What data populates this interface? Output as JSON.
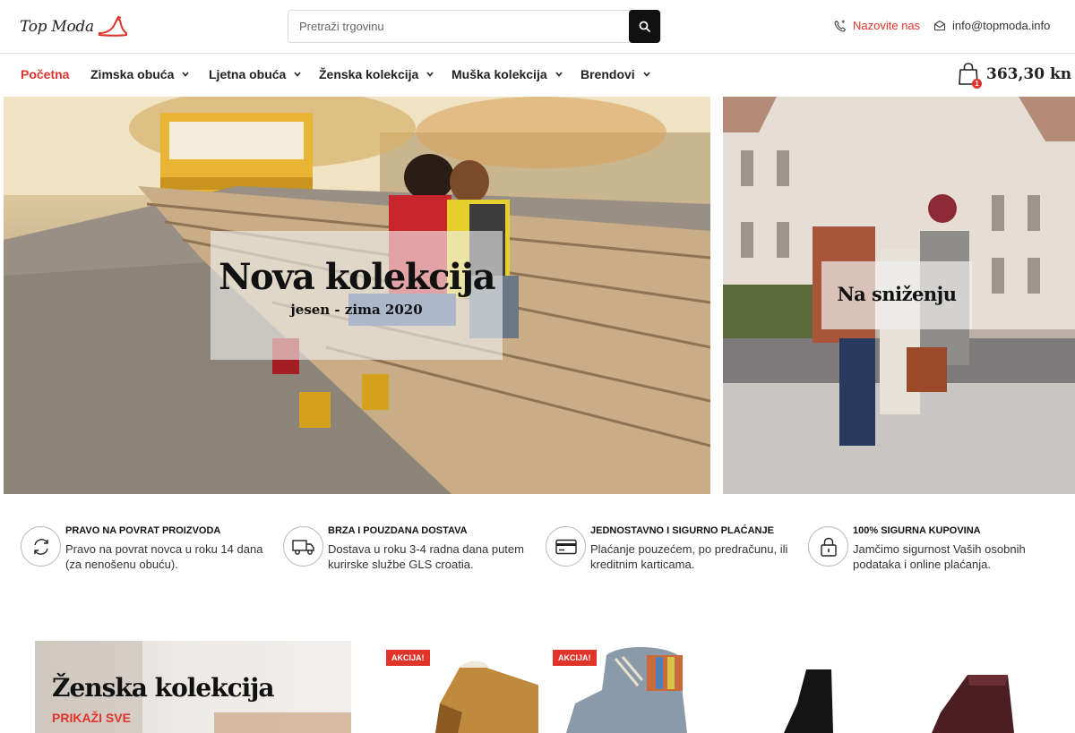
{
  "header": {
    "logo_text": "Top Moda",
    "search_placeholder": "Pretraži trgovinu",
    "phone_label": "Nazovite nas",
    "email": "info@topmoda.info"
  },
  "nav": {
    "items": [
      {
        "label": "Početna",
        "dropdown": false,
        "active": true
      },
      {
        "label": "Zimska obuća",
        "dropdown": true
      },
      {
        "label": "Ljetna obuća",
        "dropdown": true
      },
      {
        "label": "Ženska kolekcija",
        "dropdown": true
      },
      {
        "label": "Muška kolekcija",
        "dropdown": true
      },
      {
        "label": "Brendovi",
        "dropdown": true
      }
    ],
    "cart_count": "1",
    "cart_total": "363,30 kn"
  },
  "hero": {
    "left_title": "Nova kolekcija",
    "left_subtitle": "jesen - zima 2020",
    "right_title": "Na sniženju"
  },
  "features": [
    {
      "icon": "refresh-icon",
      "title": "PRAVO NA POVRAT PROIZVODA",
      "text": "Pravo na povrat novca u roku 14 dana (za nenošenu obuću)."
    },
    {
      "icon": "truck-icon",
      "title": "BRZA I POUZDANA DOSTAVA",
      "text": "Dostava u roku 3-4 radna dana putem kurirske službe GLS croatia."
    },
    {
      "icon": "credit-card-icon",
      "title": "JEDNOSTAVNO I SIGURNO PLAĆANJE",
      "text": "Plaćanje pouzećem, po predračunu, ili kreditnim karticama."
    },
    {
      "icon": "lock-icon",
      "title": "100% SIGURNA KUPOVINA",
      "text": "Jamčimo sigurnost Vaših osobnih podataka i online plaćanja."
    }
  ],
  "collection": {
    "title": "Ženska kolekcija",
    "link": "PRIKAŽI SVE"
  },
  "products": [
    {
      "badge": "AKCIJA!"
    },
    {
      "badge": "AKCIJA!"
    },
    {
      "badge": ""
    },
    {
      "badge": ""
    }
  ],
  "colors": {
    "accent": "#e0342a",
    "dark": "#111111"
  }
}
